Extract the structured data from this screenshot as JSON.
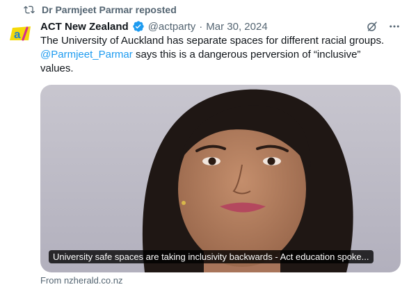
{
  "repost": {
    "text": "Dr Parmjeet Parmar reposted"
  },
  "author": {
    "display_name": "ACT New Zealand",
    "handle": "@actparty",
    "separator": "·",
    "date": "Mar 30, 2024"
  },
  "post": {
    "line1": "The University of Auckland has separate spaces for different racial groups.",
    "mention": "@Parmjeet_Parmar",
    "line2_rest": " says this is a dangerous perversion of “inclusive”",
    "line3": "values."
  },
  "card": {
    "caption": "University safe spaces are taking inclusivity backwards - Act education spoke...",
    "source": "From nzherald.co.nz"
  },
  "colors": {
    "accent": "#1d9bf0",
    "muted": "#536471",
    "logo_yellow": "#f5d90a",
    "logo_magenta": "#d62e8a"
  },
  "icons": [
    "repost-icon",
    "verified-badge-icon",
    "grok-icon",
    "more-icon"
  ]
}
